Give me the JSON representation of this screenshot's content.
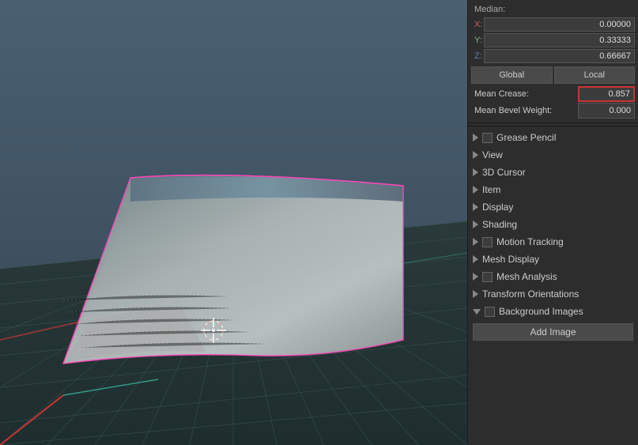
{
  "viewport": {
    "background_color": "#3d4a52"
  },
  "panel": {
    "median_label": "Median:",
    "coords": {
      "x_label": "X:",
      "x_value": "0.00000",
      "y_label": "Y:",
      "y_value": "0.33333",
      "z_label": "Z:",
      "z_value": "0.66667"
    },
    "global_label": "Global",
    "local_label": "Local",
    "mean_crease_label": "Mean Crease:",
    "mean_crease_value": "0.857",
    "mean_bevel_label": "Mean Bevel Weight:",
    "mean_bevel_value": "0.000",
    "sidebar_items": [
      {
        "id": "grease-pencil",
        "label": "Grease Pencil",
        "has_checkbox": true,
        "open": false
      },
      {
        "id": "view",
        "label": "View",
        "has_checkbox": false,
        "open": false
      },
      {
        "id": "3d-cursor",
        "label": "3D Cursor",
        "has_checkbox": false,
        "open": false
      },
      {
        "id": "item",
        "label": "Item",
        "has_checkbox": false,
        "open": false
      },
      {
        "id": "display",
        "label": "Display",
        "has_checkbox": false,
        "open": false
      },
      {
        "id": "shading",
        "label": "Shading",
        "has_checkbox": false,
        "open": false
      },
      {
        "id": "motion-tracking",
        "label": "Motion Tracking",
        "has_checkbox": true,
        "open": false
      },
      {
        "id": "mesh-display",
        "label": "Mesh Display",
        "has_checkbox": false,
        "open": false
      },
      {
        "id": "mesh-analysis",
        "label": "Mesh Analysis",
        "has_checkbox": true,
        "open": false
      },
      {
        "id": "transform-orientations",
        "label": "Transform Orientations",
        "has_checkbox": false,
        "open": false
      },
      {
        "id": "background-images",
        "label": "Background Images",
        "has_checkbox": true,
        "open": true
      }
    ],
    "add_image_label": "Add Image"
  }
}
